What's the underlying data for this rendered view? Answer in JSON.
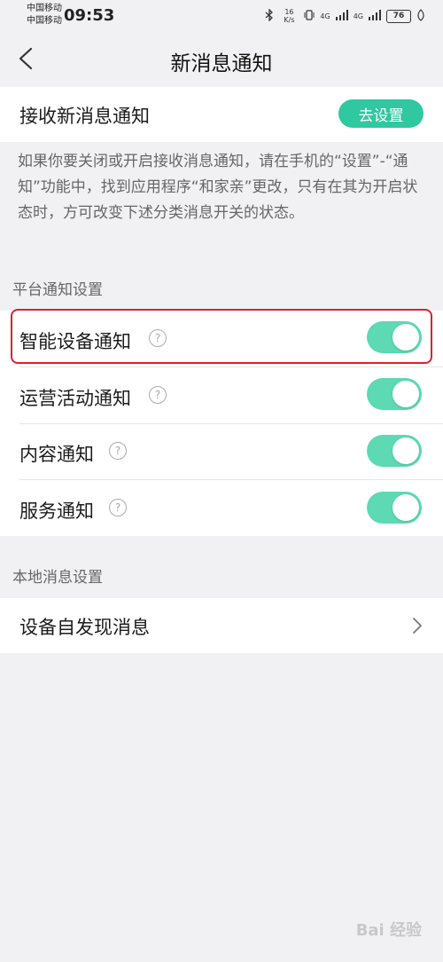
{
  "status_bar": {
    "carrier_1": "中国移动",
    "carrier_2": "中国移动",
    "time": "09:53",
    "net_speed": "16 K/s",
    "signal_1": "4G",
    "signal_2": "4G",
    "battery": "76"
  },
  "nav": {
    "title": "新消息通知"
  },
  "receive": {
    "label": "接收新消息通知",
    "button": "去设置"
  },
  "description": "如果你要关闭或开启接收消息通知，请在手机的“设置”-“通知”功能中，找到应用程序“和家亲”更改，只有在其为开启状态时，方可改变下述分类消息开关的状态。",
  "platform_section": {
    "header": "平台通知设置",
    "items": [
      {
        "label": "智能设备通知",
        "help": "?",
        "enabled": true
      },
      {
        "label": "运营活动通知",
        "help": "?",
        "enabled": true
      },
      {
        "label": "内容通知",
        "help": "?",
        "enabled": true
      },
      {
        "label": "服务通知",
        "help": "?",
        "enabled": true
      }
    ]
  },
  "local_section": {
    "header": "本地消息设置",
    "items": [
      {
        "label": "设备自发现消息"
      }
    ]
  },
  "watermark": "Bai 经验",
  "colors": {
    "accent": "#2fc8a0",
    "toggle_on": "#5dd9b4",
    "highlight": "#d9232e"
  }
}
